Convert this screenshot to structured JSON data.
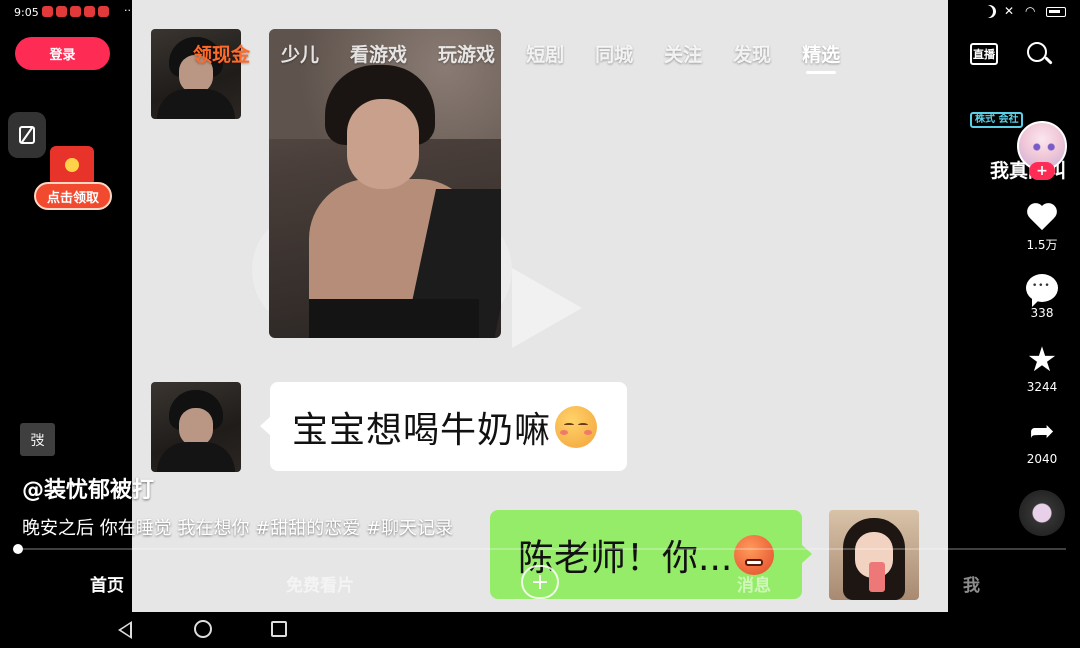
{
  "status_bar": {
    "time": "9:05",
    "more": "···"
  },
  "top_nav": {
    "login_label": "登录",
    "tabs": [
      "领现金",
      "少儿",
      "看游戏",
      "玩游戏",
      "短剧",
      "同城",
      "关注",
      "发现",
      "精选"
    ],
    "active_tab": "精选",
    "live_label": "直播"
  },
  "promo": {
    "claim_label": "点击领取"
  },
  "video": {
    "chat_text_received": "宝宝想喝牛奶嘛",
    "chat_text_sent": "陈老师！你..."
  },
  "post": {
    "badge": "弢",
    "author": "@装忧郁被打",
    "caption": "晚安之后 你在睡觉 我在想你 #甜甜的恋爱 #聊天记录",
    "progress": 0.0
  },
  "right_rail": {
    "sticker_chip": "株式 会社",
    "sticker_tail": "我真的叫",
    "follow_plus": "+",
    "likes": "1.5万",
    "comments": "338",
    "favorites": "3244",
    "shares": "2040"
  },
  "bottom_nav": {
    "home": "首页",
    "free": "免费看片",
    "create": "+",
    "messages": "消息",
    "me": "我"
  },
  "colors": {
    "brand_red": "#fe2c55",
    "gold_tab": "#ff6a2a",
    "wechat_green": "#95ec69"
  }
}
